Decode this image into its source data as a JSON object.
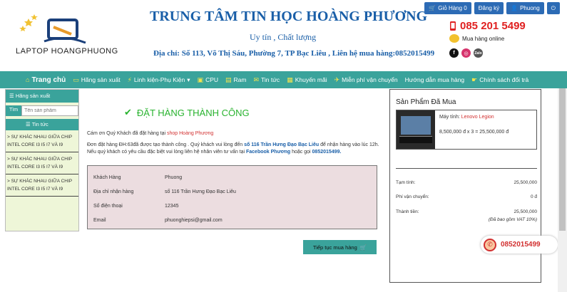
{
  "header": {
    "logo_text": "LAPTOP HOANGPHUONG",
    "site_title": "TRUNG TÂM TIN HỌC HOÀNG PHƯƠNG",
    "slogan": "Uy tín , Chất lượng",
    "address": "Địa chỉ: Số 113, Võ Thị Sáu, Phường 7, TP Bạc Liêu , Liên hệ mua hàng:0852015499",
    "hotline": "085 201 5499",
    "online_label": "Mua hàng online",
    "social_zalo": "Zalo"
  },
  "top_buttons": {
    "cart": "Giỏ Hàng 0",
    "register": "Đăng ký",
    "user": "Phuong"
  },
  "nav": {
    "items": [
      "Trang chủ",
      "Hãng sản xuất",
      "Linh kiện-Phụ Kiện",
      "CPU",
      "Ram",
      "Tin tức",
      "Khuyến mãi",
      "Miễn phí vận chuyển",
      "Hướng dẫn mua hàng",
      "Chính sách đổi trả"
    ]
  },
  "sidebar": {
    "head": "Hãng sản xuất",
    "search_btn": "Tìm",
    "search_placeholder": "Tên sản phẩm",
    "news_head": "Tin tức",
    "news": [
      "> SỰ KHÁC NHAU GIỮA CHIP INTEL CORE I3 I5 I7 VÀ I9",
      "> SỰ KHÁC NHAU GIỮA CHIP INTEL CORE I3 I5 I7 VÀ I9",
      "> SỰ KHÁC NHAU GIỮA CHIP INTEL CORE I3 I5 I7 VÀ I9"
    ]
  },
  "main": {
    "success": "ĐẶT HÀNG THÀNH CÔNG",
    "thanks_prefix": "Cám ơn Quý Khách đã đặt hàng tại ",
    "thanks_shop": "shop Hoàng Phương",
    "info_1": "Đơn đặt hàng ĐH:63đã được tạo thành công . Quý khách vui lòng đến ",
    "info_addr": "số 116 Trần Hưng Đạo Bạc Liêu",
    "info_2": " để nhận hàng vào lúc 12h.",
    "info_3": "Nếu quý khách có yêu cầu đặc biệt vui lòng liên hệ nhân viên tư vấn tại ",
    "info_fb": "Facebook Phương",
    "info_4": " hoặc gọi ",
    "info_phone": "0852015499.",
    "rows": [
      {
        "label": "Khách Hàng",
        "value": "Phuong"
      },
      {
        "label": "Địa chỉ nhận hàng",
        "value": "số 116 Trần Hưng Đạo Bạc Liêu"
      },
      {
        "label": "Số điện thoại",
        "value": "12345"
      },
      {
        "label": "Email",
        "value": "phuonghiepsi@gmail.com"
      }
    ],
    "continue_btn": "Tiếp tục mua hàng"
  },
  "cart": {
    "title": "Sản Phẩm Đã Mua",
    "item_prefix": "Máy tính: ",
    "item_name": "Lenovo Legion",
    "item_price": "8,500,000 đ x 3 = 25,500,000 đ",
    "subtotal_label": "Tạm tính:",
    "subtotal": "25,500,000",
    "shipping_label": "Phí vận chuyển:",
    "shipping": "0 đ",
    "total_label": "Thành tiền:",
    "total": "25,500,000",
    "vat_note": "(Đã bao gồm VAT 10%)"
  },
  "float_phone": "0852015499"
}
